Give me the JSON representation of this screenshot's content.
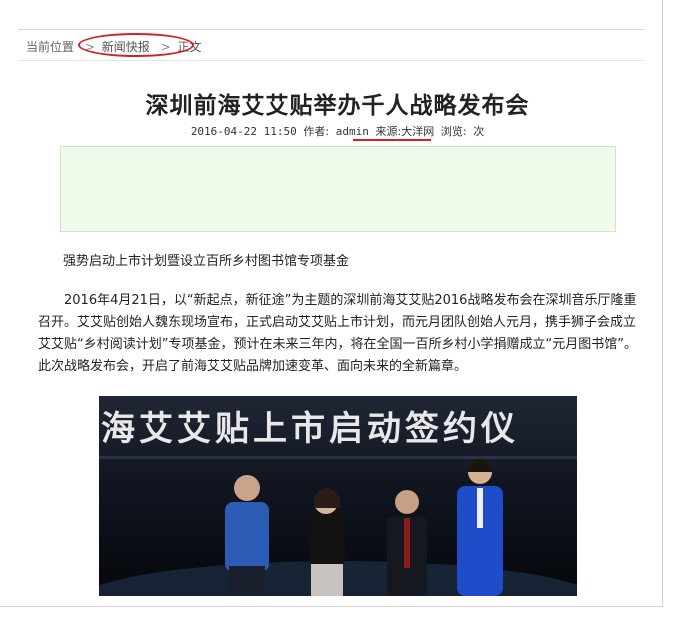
{
  "breadcrumb": {
    "prefix": "当前位置",
    "items": [
      "新闻快报",
      "正文"
    ],
    "separator": ">"
  },
  "article": {
    "title": "深圳前海艾艾贴举办千人战略发布会",
    "meta": {
      "datetime": "2016-04-22 11:50",
      "author_label": "作者:",
      "author": "admin",
      "source_label": "来源:",
      "source": "大洋网",
      "views_label": "浏览:",
      "views_suffix": "次"
    },
    "subheading": "强势启动上市计划暨设立百所乡村图书馆专项基金",
    "paragraph": "2016年4月21日，以“新起点，新征途”为主题的深圳前海艾艾贴2016战略发布会在深圳音乐厅隆重召开。艾艾贴创始人魏东现场宣布，正式启动艾艾贴上市计划，而元月团队创始人元月，携手狮子会成立艾艾贴“乡村阅读计划”专项基金，预计在未来三年内，将在全国一百所乡村小学捐赠成立“元月图书馆”。此次战略发布会，开启了前海艾艾贴品牌加速变革、面向未来的全新篇章。",
    "photo_banner": "海艾艾贴上市启动签约仪"
  },
  "colors": {
    "annotation_red": "#d42020",
    "ad_box_bg": "#effaeb"
  }
}
